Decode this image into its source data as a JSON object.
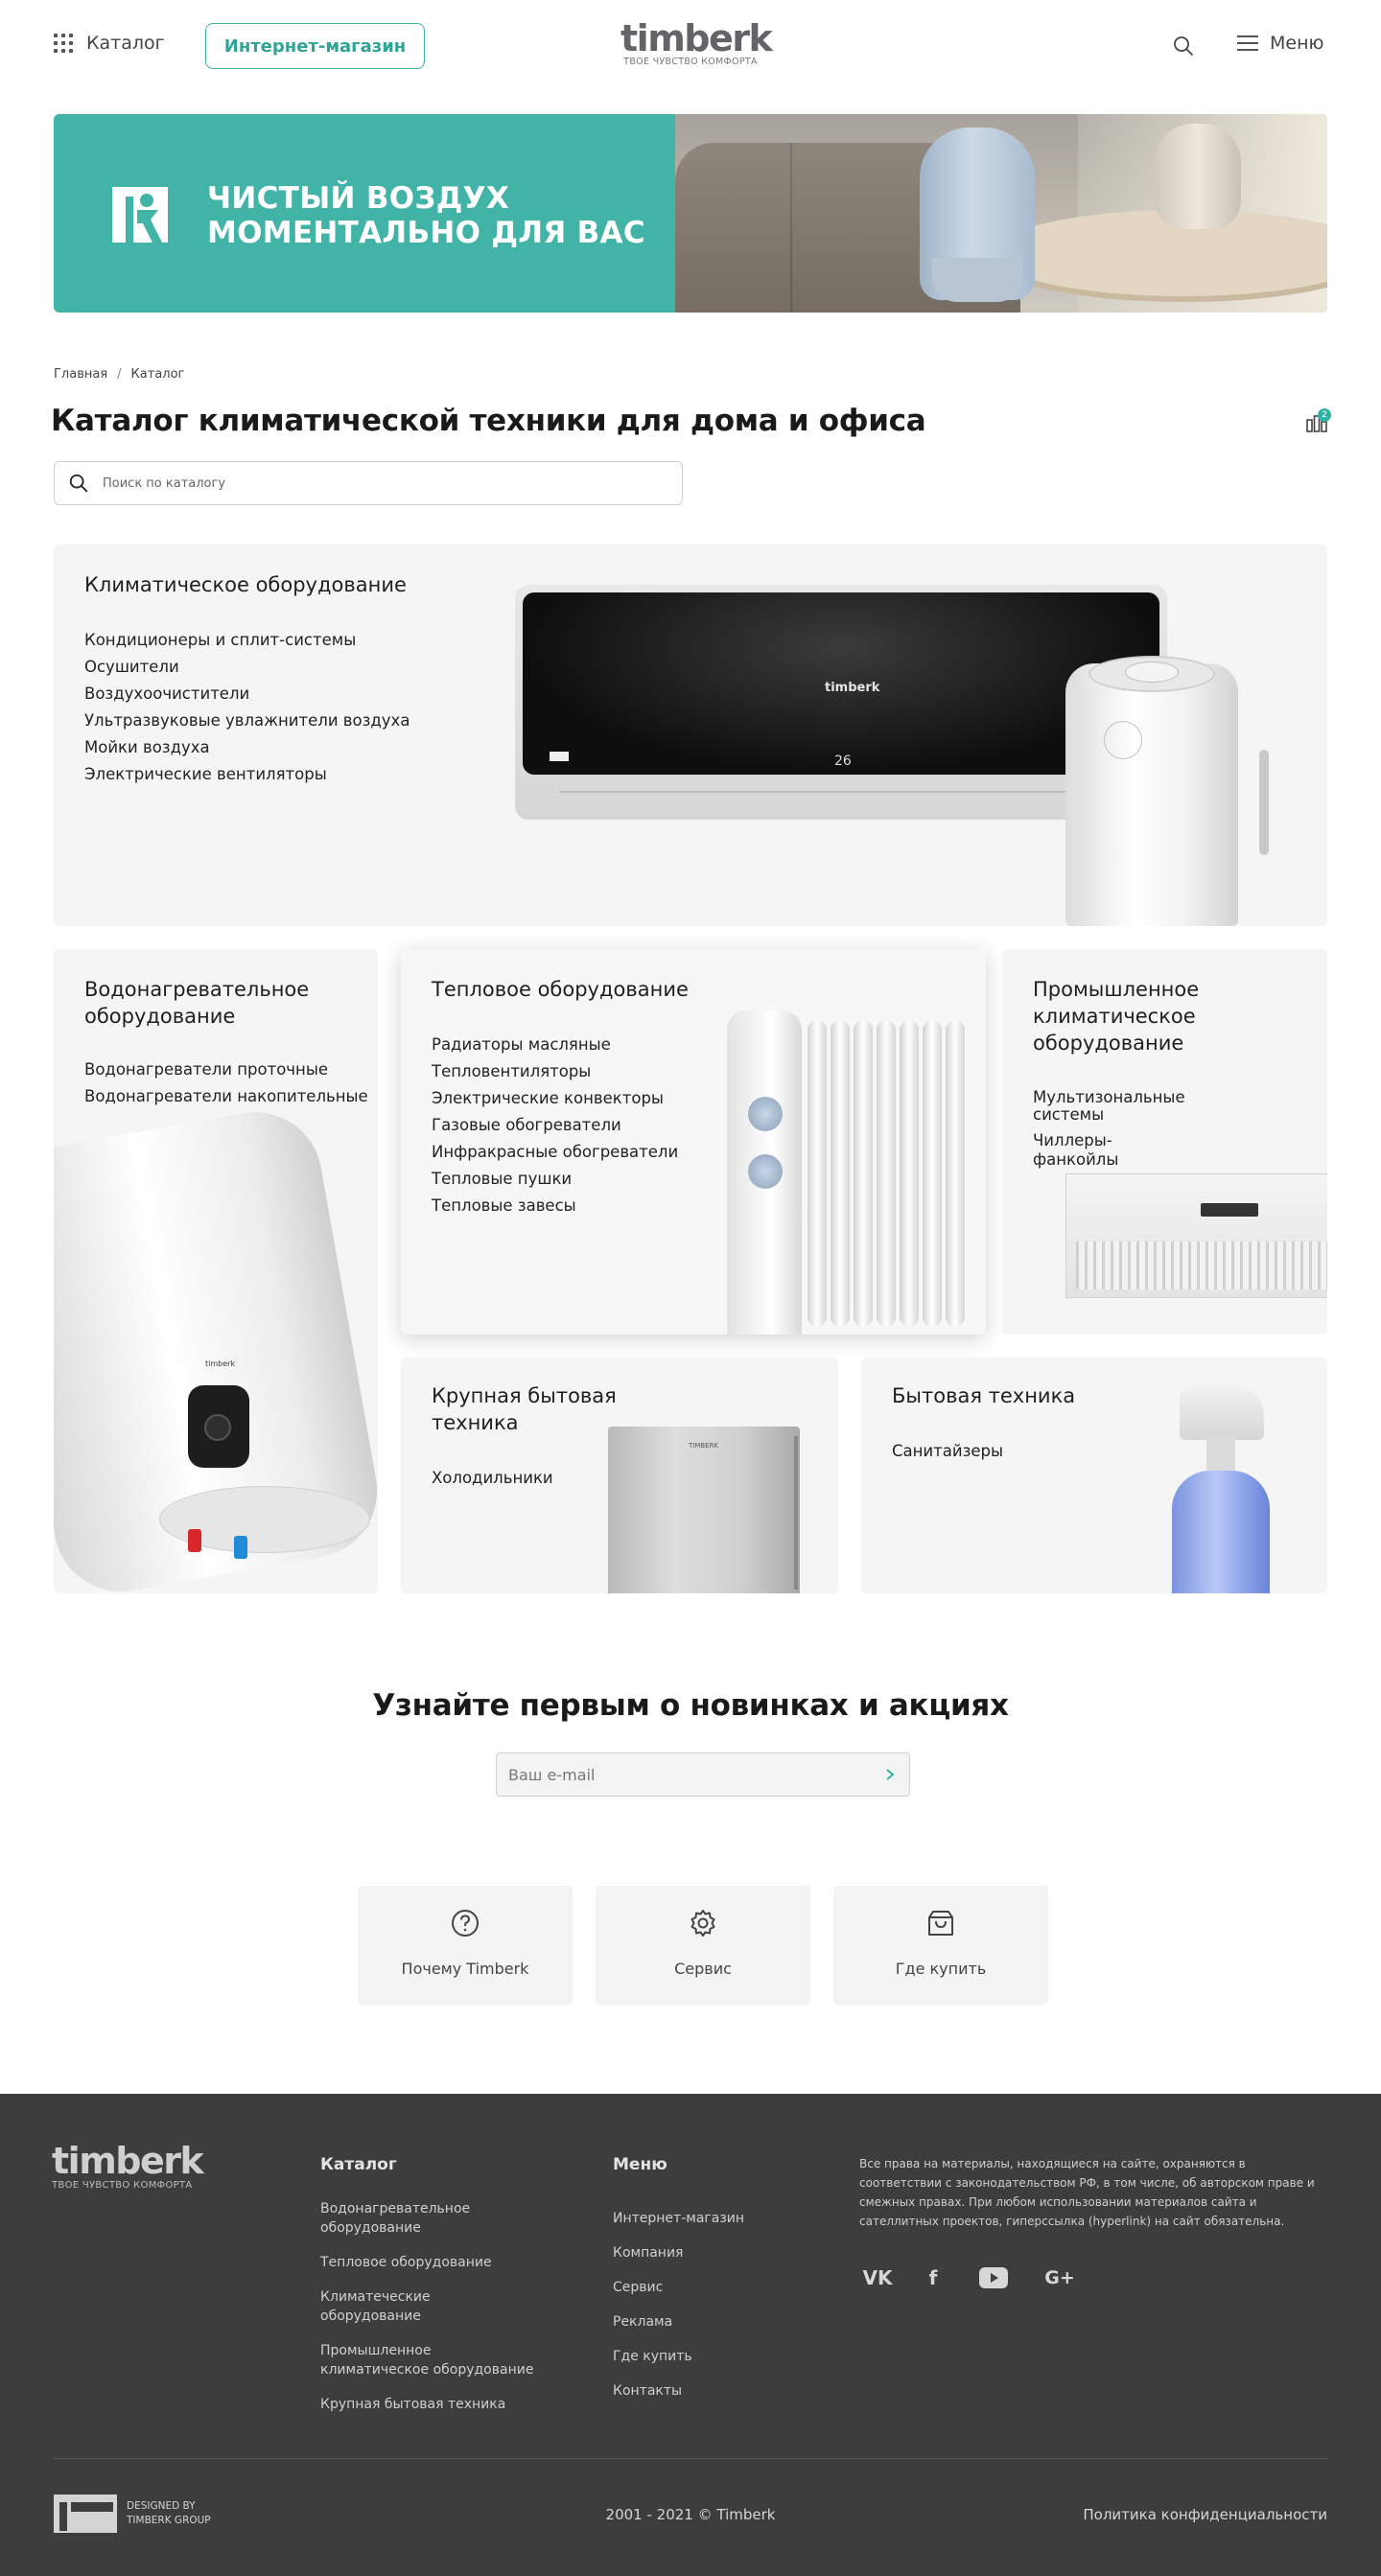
{
  "header": {
    "catalog_label": "Каталог",
    "shop_button": "Интернет-магазин",
    "logo_word": "timberk",
    "logo_tagline": "ТВОЕ ЧУВСТВО КОМФОРТА",
    "menu_label": "Меню"
  },
  "banner": {
    "title_line1": "ЧИСТЫЙ ВОЗДУХ",
    "title_line2": "МОМЕНТАЛЬНО ДЛЯ ВАС"
  },
  "breadcrumb": [
    "Главная",
    "Каталог"
  ],
  "page_title": "Каталог климатической техники для дома и офиса",
  "compare_count": "2",
  "search": {
    "placeholder": "Поиск по каталогу"
  },
  "categories": {
    "climate": {
      "title": "Климатическое оборудование",
      "items": [
        "Кондиционеры и сплит-системы",
        "Осушители",
        "Воздухоочистители",
        "Ультразвуковые увлажнители воздуха",
        "Мойки воздуха",
        "Электрические вентиляторы"
      ],
      "ac_brand": "timberk",
      "ac_display": "26"
    },
    "water": {
      "title_line1": "Водонагревательное",
      "title_line2": "оборудование",
      "items": [
        "Водонагреватели проточные",
        "Водонагреватели накопительные"
      ],
      "brand": "timberk"
    },
    "heat": {
      "title": "Тепловое оборудование",
      "items": [
        "Радиаторы масляные",
        "Тепловентиляторы",
        "Электрические конвекторы",
        "Газовые обогреватели",
        "Инфракрасные обогреватели",
        "Тепловые пушки",
        "Тепловые завесы"
      ]
    },
    "industrial": {
      "title_line1": "Промышленное",
      "title_line2": "климатическое",
      "title_line3": "оборудование",
      "items": [
        "Мультизональные системы",
        "Чиллеры-фанкойлы"
      ]
    },
    "large": {
      "title_line1": "Крупная бытовая",
      "title_line2": "техника",
      "items": [
        "Холодильники"
      ],
      "fridge_brand": "TIMBERK"
    },
    "household": {
      "title": "Бытовая техника",
      "items": [
        "Санитайзеры"
      ]
    }
  },
  "subscribe": {
    "title": "Узнайте первым о новинках и акциях",
    "placeholder": "Ваш e-mail"
  },
  "quick_links": [
    {
      "label": "Почему Timberk",
      "icon": "question-icon"
    },
    {
      "label": "Сервис",
      "icon": "gear-icon"
    },
    {
      "label": "Где купить",
      "icon": "shopping-bag-icon"
    }
  ],
  "footer": {
    "logo_word": "timberk",
    "logo_tagline": "ТВОЕ ЧУВСТВО КОМФОРТА",
    "catalog_title": "Каталог",
    "catalog_items": [
      "Водонагревательное оборудование",
      "Тепловое оборудование",
      "Климатеческие оборудование",
      "Промышленное климатическое оборудование",
      "Крупная бытовая техника"
    ],
    "menu_title": "Меню",
    "menu_items": [
      "Интернет-магазин",
      "Компания",
      "Сервис",
      "Реклама",
      "Где купить",
      "Контакты"
    ],
    "legal": "Все права на материалы, находящиеся на сайте, охраняются в соответствии с законодательством РФ, в том числе, об авторском праве и смежных правах. При любом использовании материалов сайта и сателлитных проектов, гиперссылка (hyperlink) на сайт обязательна.",
    "designed_by": "DESIGNED BY TIMBERK GROUP",
    "copyright": "2001 - 2021 © Timberk",
    "policy": "Политика конфиденциальности",
    "social": [
      "vk-icon",
      "facebook-icon",
      "youtube-icon",
      "google-plus-icon"
    ]
  },
  "colors": {
    "accent": "#2fb3a5",
    "banner": "#41b4a7",
    "footer_bg": "#3d3d3d",
    "card_bg": "#f5f5f5"
  }
}
